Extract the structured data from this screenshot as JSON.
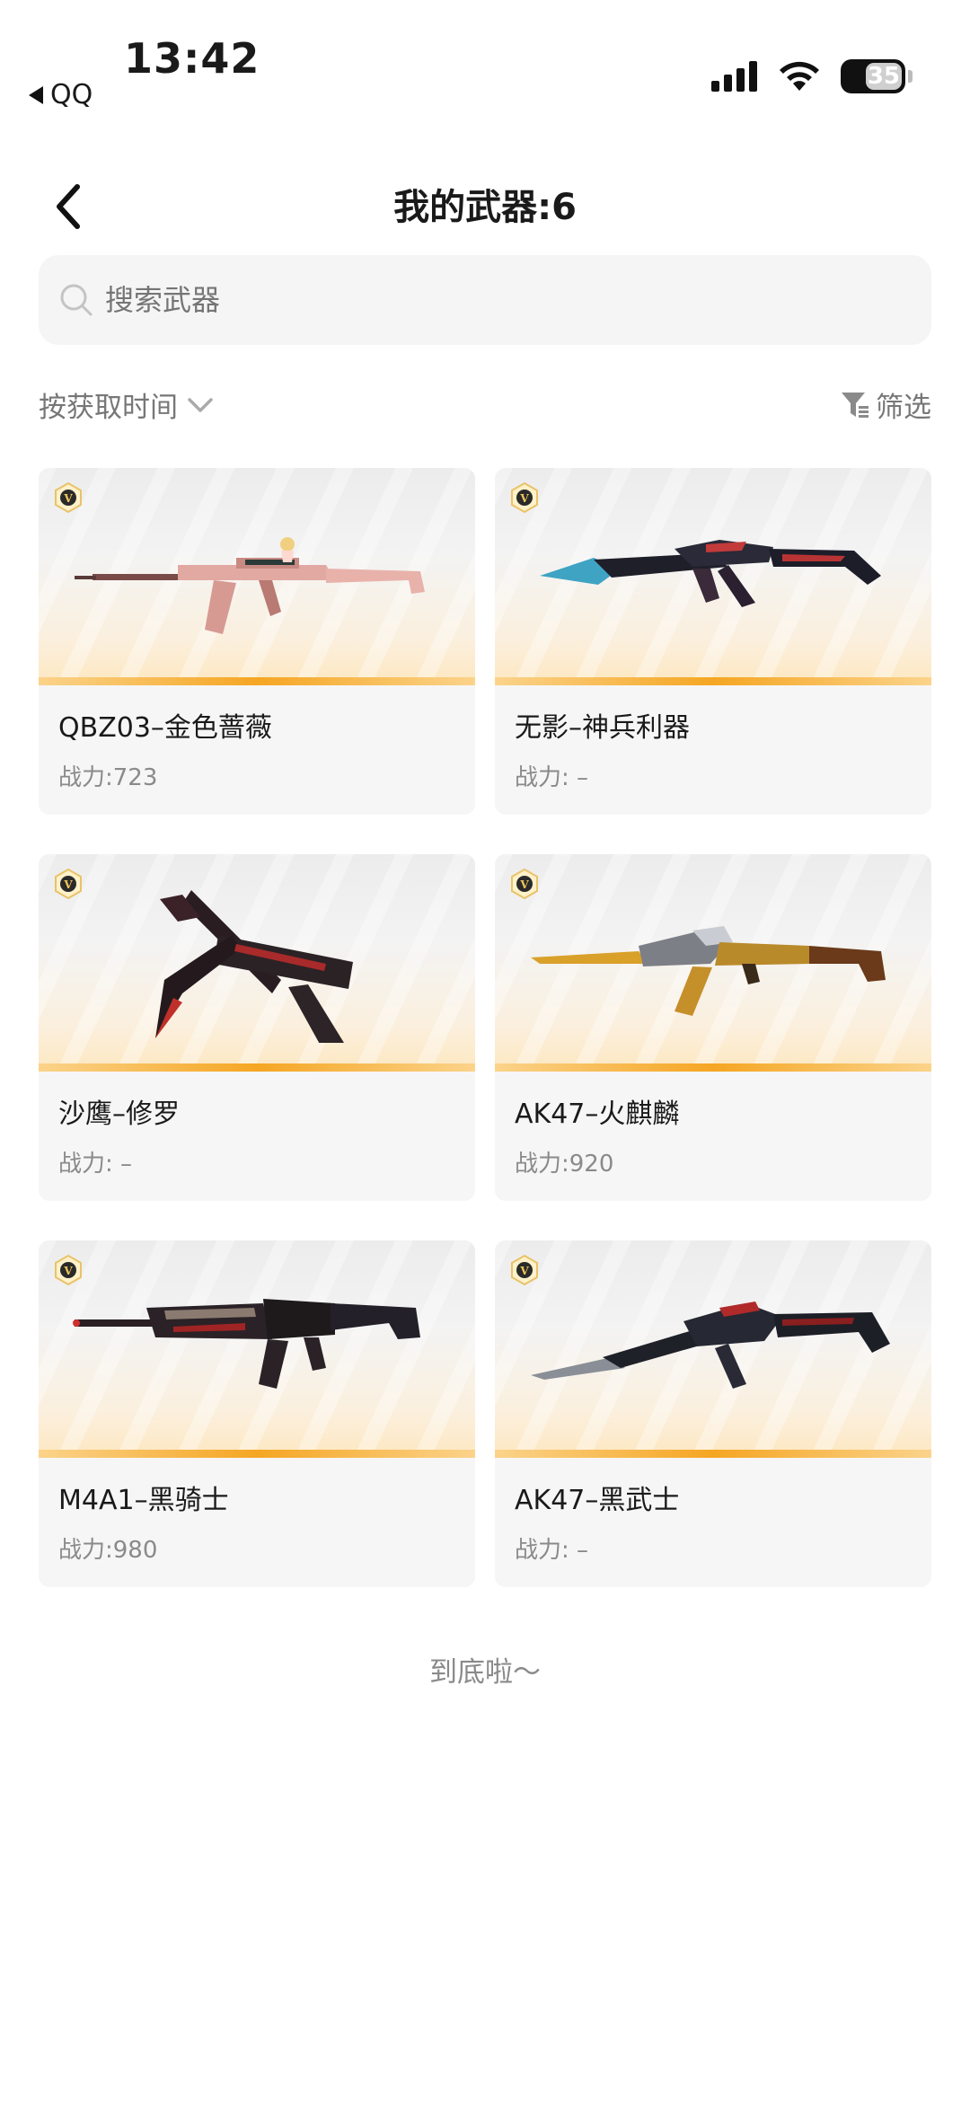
{
  "status_bar": {
    "time": "13:42",
    "back_app": "QQ",
    "battery": "35"
  },
  "nav": {
    "title": "我的武器:6"
  },
  "search": {
    "placeholder": "搜索武器"
  },
  "toolbar": {
    "sort_label": "按获取时间",
    "filter_label": "筛选"
  },
  "weapons": [
    {
      "name": "QBZ03–金色蔷薇",
      "power": "战力:723"
    },
    {
      "name": "无影–神兵利器",
      "power": "战力: –"
    },
    {
      "name": "沙鹰–修罗",
      "power": "战力: –"
    },
    {
      "name": "AK47–火麒麟",
      "power": "战力:920"
    },
    {
      "name": "M4A1–黑骑士",
      "power": "战力:980"
    },
    {
      "name": "AK47–黑武士",
      "power": "战力: –"
    }
  ],
  "footer": {
    "end_text": "到底啦～"
  },
  "colors": {
    "accent_orange": "#f5a623",
    "card_bg": "#f6f6f6",
    "muted_text": "#8a8a8a"
  }
}
